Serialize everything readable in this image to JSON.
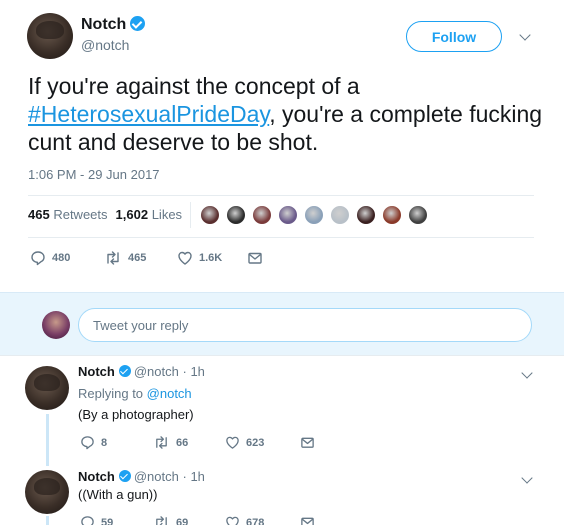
{
  "tweet": {
    "author_name": "Notch",
    "author_handle": "@notch",
    "follow_label": "Follow",
    "text_before": "If you're against the concept of a ",
    "hashtag": "#HeterosexualPrideDay",
    "text_after": ", you're a complete fucking cunt and deserve to be shot.",
    "timestamp": "1:06 PM - 29 Jun 2017",
    "retweets_count": "465",
    "retweets_label": "Retweets",
    "likes_count": "1,602",
    "likes_label": "Likes",
    "actions": {
      "reply_count": "480",
      "retweet_count": "465",
      "like_count": "1.6K"
    },
    "likers": [
      "#5a2f2f",
      "#2b2b2b",
      "#7a3b3b",
      "#6a5a8a",
      "#8aa0b8",
      "#b8c0c8",
      "#3a2020",
      "#8a3a2a",
      "#404040"
    ]
  },
  "reply_box": {
    "placeholder": "Tweet your reply"
  },
  "replies": [
    {
      "name": "Notch",
      "handle": "@notch",
      "dot": "·",
      "time": "1h",
      "replying_prefix": "Replying to ",
      "replying_to": "@notch",
      "text": "(By a photographer)",
      "reply_count": "8",
      "retweet_count": "66",
      "like_count": "623"
    },
    {
      "name": "Notch",
      "handle": "@notch",
      "dot": "·",
      "time": "1h",
      "text": "((With a gun))",
      "reply_count": "59",
      "retweet_count": "69",
      "like_count": "678"
    }
  ],
  "colors": {
    "accent": "#1da1f2",
    "link": "#1b95e0",
    "muted": "#657786",
    "reply_area_bg": "#e8f5fd"
  }
}
